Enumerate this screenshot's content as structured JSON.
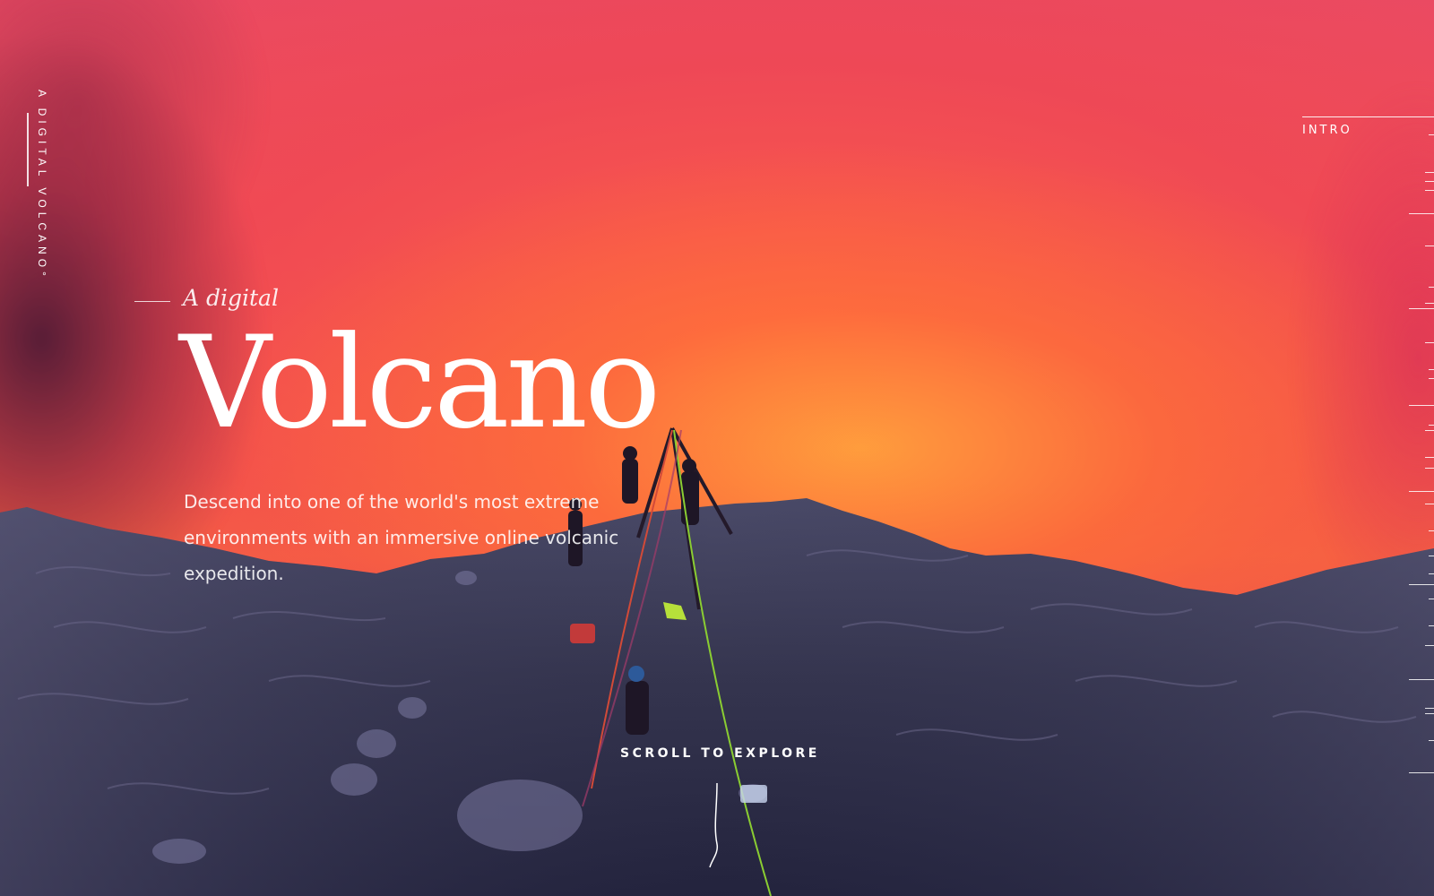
{
  "side": {
    "title": "A DIGITAL VOLCANO°"
  },
  "nav": {
    "current_section": "INTRO"
  },
  "hero": {
    "kicker": "A digital",
    "title": "Volcano",
    "description": "Descend into one of the world's most extreme environments with an immersive online volcanic expedition."
  },
  "scroll": {
    "label": "SCROLL TO EXPLORE"
  },
  "colors": {
    "lava": "#f86047",
    "sky": "#ea4a63",
    "rock": "#3a3a55",
    "text": "#ffffff"
  }
}
